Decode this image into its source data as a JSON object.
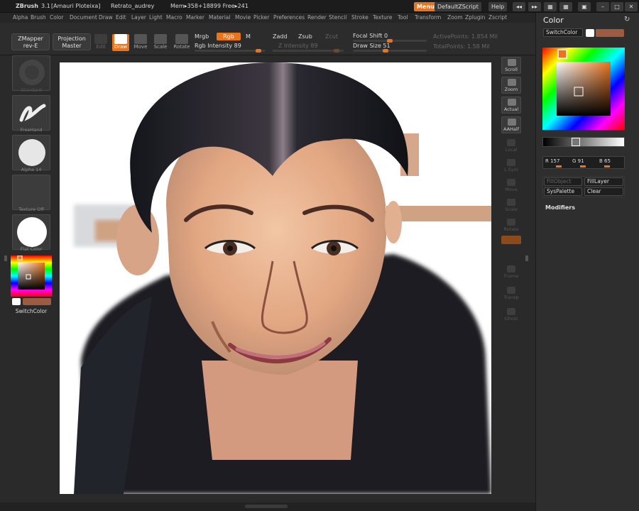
{
  "titlebar": {
    "app": "ZBrush",
    "version": "3.1",
    "user": "[Amauri Ploteixa]",
    "doc": "Retrato_audrey",
    "mem": "Mem▸358+18899 Free▸241",
    "menus_btn": "Menus",
    "script_btn": "DefaultZScript",
    "help_btn": "Help"
  },
  "menubar": [
    "Alpha",
    "Brush",
    "Color",
    "Document",
    "Draw",
    "Edit",
    "Layer",
    "Light",
    "Macro",
    "Marker",
    "Material",
    "Movie",
    "Picker",
    "Preferences",
    "Render",
    "Stencil",
    "Stroke",
    "Texture",
    "Tool",
    "Transform",
    "Zoom",
    "Zplugin",
    "Zscript"
  ],
  "toolbar": {
    "zmapper": "ZMapper",
    "zmapper_sub": "rev-E",
    "projection": "Projection",
    "projection_sub": "Master",
    "edit": "Edit",
    "draw": "Draw",
    "move": "Move",
    "scale": "Scale",
    "rotate": "Rotate",
    "mrgb": "Mrgb",
    "rgb": "Rgb",
    "m": "M",
    "rgb_intensity": "Rgb Intensity 89",
    "zadd": "Zadd",
    "zsub": "Zsub",
    "zcut": "Zcut",
    "z_intensity": "Z Intensity 89",
    "focal_shift": "Focal Shift 0",
    "draw_size": "Draw Size 51",
    "active_points": "ActivePoints: 1.854 Mil",
    "total_points": "TotalPoints: 1.58 Mil"
  },
  "leftpanel": {
    "standard": "Standard",
    "freehand": "FreeHand",
    "alpha": "Alpha 14",
    "texture": "Texture Off",
    "material": "Flat Color",
    "switchcolor": "SwitchColor"
  },
  "righttools": [
    "Scroll",
    "Zoom",
    "Actual",
    "AAHalf",
    "Local",
    "L.Sym",
    "Move",
    "Scale",
    "Rotate",
    "",
    "Frame",
    "Transp",
    "Ghost"
  ],
  "rightpanel": {
    "title": "Color",
    "switchcolor": "SwitchColor",
    "r": "R 157",
    "g": "G 91",
    "b": "B 65",
    "fillobject": "FillObject",
    "filllayer": "FillLayer",
    "syspalette": "SysPalette",
    "clear": "Clear",
    "modifiers": "Modifiers"
  },
  "colors": {
    "accent": "#e8741e",
    "main_color": "#9d5b41",
    "secondary_color": "#ffffff"
  }
}
